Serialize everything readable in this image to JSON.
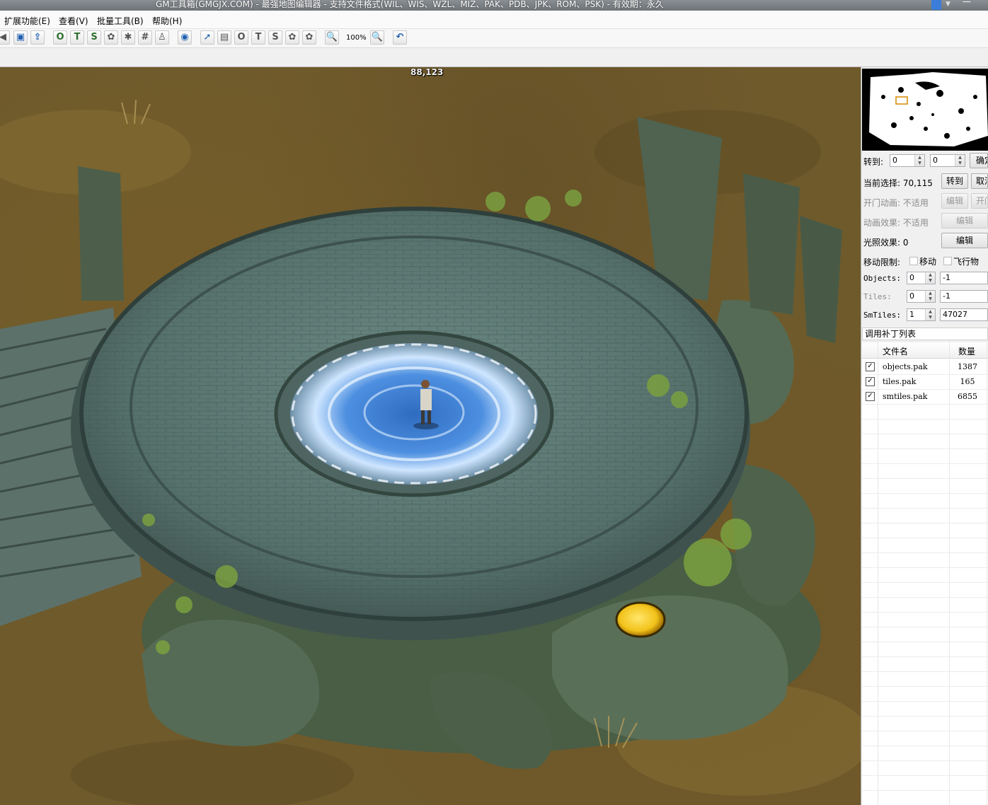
{
  "titlebar": {
    "title": "GM工具箱(GMGJX.COM) - 最强地图编辑器 - 支持文件格式(WIL、WIS、WZL、MIZ、PAK、PDB、JPK、ROM、PSK) - 有效期：永久"
  },
  "menu": {
    "items": [
      "扩展功能(E)",
      "查看(V)",
      "批量工具(B)",
      "帮助(H)"
    ]
  },
  "toolbar": {
    "buttons": [
      {
        "name": "back-arrow-icon",
        "glyph": "◀"
      },
      {
        "name": "image-icon",
        "glyph": "▣"
      },
      {
        "name": "upload-icon",
        "glyph": "⇪"
      },
      {
        "name": "objects-o-button",
        "glyph": "O"
      },
      {
        "name": "tiles-t-button",
        "glyph": "T"
      },
      {
        "name": "smtiles-s-button",
        "glyph": "S"
      },
      {
        "name": "flower-icon",
        "glyph": "✿"
      },
      {
        "name": "asterisk-icon",
        "glyph": "✱"
      },
      {
        "name": "grid-icon",
        "glyph": "#"
      },
      {
        "name": "person-icon",
        "glyph": "♙"
      },
      {
        "name": "eye-icon",
        "glyph": "◉"
      },
      {
        "name": "select-pointer-icon",
        "glyph": "➚"
      },
      {
        "name": "stamp-icon",
        "glyph": "▤"
      },
      {
        "name": "objects-o2-button",
        "glyph": "O"
      },
      {
        "name": "tiles-t2-button",
        "glyph": "T"
      },
      {
        "name": "smtiles-s2-button",
        "glyph": "S"
      },
      {
        "name": "flower2-icon",
        "glyph": "✿"
      },
      {
        "name": "flower3-icon",
        "glyph": "✿"
      },
      {
        "name": "zoom-out-icon",
        "glyph": "🔍"
      },
      {
        "name": "zoom-in-icon",
        "glyph": "🔍"
      },
      {
        "name": "undo-icon",
        "glyph": "↶"
      }
    ],
    "zoom": "100%"
  },
  "canvas": {
    "coord": "88,123"
  },
  "sidebar": {
    "goto_label": "转到:",
    "goto_x": "0",
    "goto_y": "0",
    "confirm_button": "确定",
    "current_label": "当前选择: 70,115",
    "goto_button": "转到",
    "cancel_button": "取消",
    "door_anim_label": "开门动画: 不适用",
    "door_edit": "编辑",
    "door_open": "开门",
    "anim_effect_label": "动画效果: 不适用",
    "anim_edit": "编辑",
    "light_label": "光照效果: 0",
    "light_edit": "编辑",
    "move_limit_label": "移动限制:",
    "move_option": "移动",
    "fly_option": "飞行物",
    "objects_label": "Objects:",
    "objects_a": "0",
    "objects_b": "-1",
    "tiles_label": "Tiles:",
    "tiles_a": "0",
    "tiles_b": "-1",
    "smtiles_label": "SmTiles:",
    "smtiles_a": "1",
    "smtiles_b": "47027",
    "patch_list_title": "调用补丁列表",
    "grid_header_name": "文件名",
    "grid_header_qty": "数量",
    "patches": [
      {
        "file": "objects.pak",
        "qty": "1387",
        "checked": "✓"
      },
      {
        "file": "tiles.pak",
        "qty": "165",
        "checked": "✓"
      },
      {
        "file": "smtiles.pak",
        "qty": "6855",
        "checked": "✓"
      }
    ]
  },
  "colors": {
    "moss": "#6b8a3a",
    "stone": "#5b7670",
    "portal": "#3d7fd0",
    "eye": "#f2c21a"
  }
}
